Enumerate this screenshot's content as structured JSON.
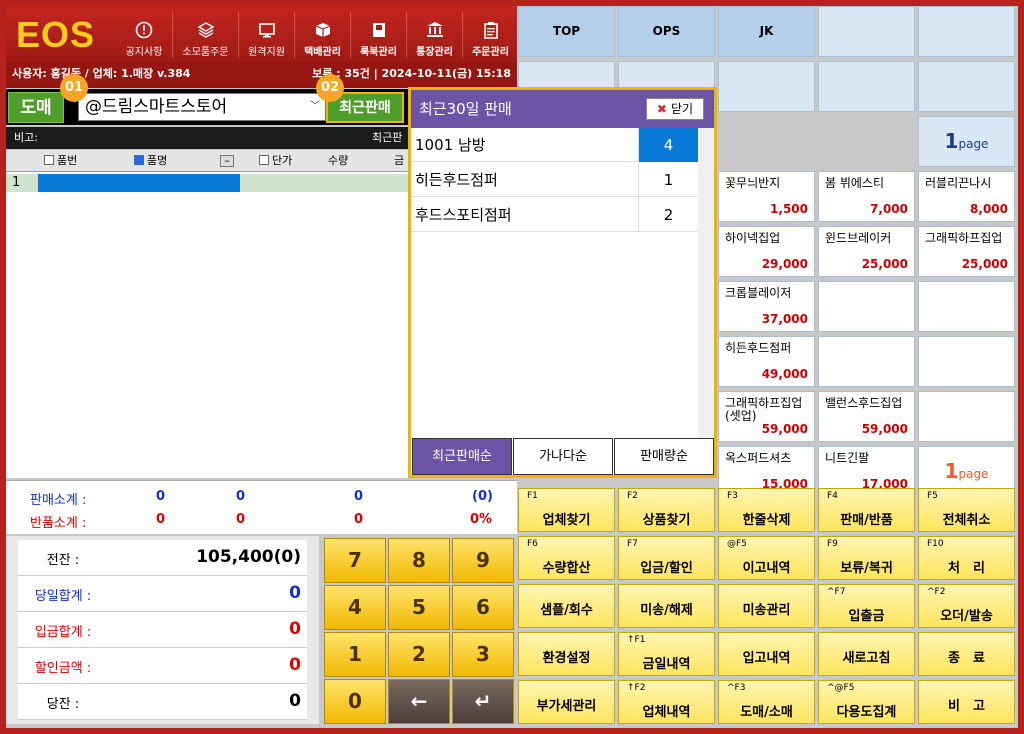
{
  "app": {
    "logo": "EOS"
  },
  "menu": [
    {
      "label": "공지사항",
      "icon": "alert-circle-icon",
      "bold": false
    },
    {
      "label": "소모품주문",
      "icon": "layers-icon",
      "bold": false
    },
    {
      "label": "원격지원",
      "icon": "monitor-icon",
      "bold": false
    },
    {
      "label": "택배관리",
      "icon": "box-icon",
      "bold": true
    },
    {
      "label": "룩북관리",
      "icon": "book-icon",
      "bold": true
    },
    {
      "label": "통장관리",
      "icon": "bank-icon",
      "bold": true
    },
    {
      "label": "주문관리",
      "icon": "clipboard-icon",
      "bold": true
    }
  ],
  "info": {
    "left": "사용자: 홍길동 / 업체: 1.매장 v.384",
    "right": "보류 : 35건 | 2024-10-11(금) 15:18"
  },
  "toolbar": {
    "mode": "도매",
    "store": "@드림스마트스토어",
    "recent_button": "최근판매",
    "badge1": "01",
    "badge2": "02"
  },
  "memo": {
    "label": "비고:",
    "right": "최근판"
  },
  "grid": {
    "headers": {
      "code": "품번",
      "name": "품명",
      "collapse": "–",
      "unit": "단가",
      "qty": "수량",
      "amount": "금"
    },
    "row_no": "1"
  },
  "totals": {
    "sales_label": "판매소계 :",
    "sales": [
      "0",
      "0",
      "0",
      "(0)"
    ],
    "return_label": "반품소계 :",
    "returns": [
      "0",
      "0",
      "0",
      "0%"
    ]
  },
  "balances": [
    {
      "label": "전잔 :",
      "value": "105,400(0)",
      "color": "#000000"
    },
    {
      "label": "당일합계 :",
      "value": "0",
      "color": "#1030d0"
    },
    {
      "label": "입금합계 :",
      "value": "0",
      "color": "#e00000"
    },
    {
      "label": "할인금액 :",
      "value": "0",
      "color": "#e00000"
    },
    {
      "label": "당잔 :",
      "value": "0",
      "color": "#000000"
    }
  ],
  "numpad": [
    "7",
    "8",
    "9",
    "4",
    "5",
    "6",
    "1",
    "2",
    "3",
    "0",
    "←",
    "↵"
  ],
  "top_tabs": [
    "TOP",
    "OPS",
    "JK"
  ],
  "products": [
    {
      "name": "꽃무늬반지",
      "price": "1,500"
    },
    {
      "name": "봄 뷔에스티",
      "price": "7,000"
    },
    {
      "name": "러블리끈나시",
      "price": "8,000"
    },
    {
      "name": "하이넥집업",
      "price": "29,000"
    },
    {
      "name": "윈드브레이커",
      "price": "25,000"
    },
    {
      "name": "그래픽하프집업",
      "price": "25,000"
    },
    {
      "name": "크롭블레이저",
      "price": "37,000"
    },
    {
      "name": "히든후드점퍼",
      "price": "49,000"
    },
    {
      "name": "그래픽하프집업(셋업)",
      "price": "59,000"
    },
    {
      "name": "밸런스후드집업",
      "price": "59,000"
    },
    {
      "name": "옥스퍼드셔츠",
      "price": "15,000"
    },
    {
      "name": "니트긴팔",
      "price": "17,000"
    }
  ],
  "pages": {
    "top": "1",
    "bottom": "1",
    "unit": "page"
  },
  "fkeys": [
    {
      "key": "F1",
      "label": "업체찾기"
    },
    {
      "key": "F2",
      "label": "상품찾기"
    },
    {
      "key": "F3",
      "label": "한줄삭제"
    },
    {
      "key": "F4",
      "label": "판매/반품"
    },
    {
      "key": "F5",
      "label": "전체취소"
    },
    {
      "key": "F6",
      "label": "수량합산"
    },
    {
      "key": "F7",
      "label": "입금/할인"
    },
    {
      "key": "@F5",
      "label": "이고내역"
    },
    {
      "key": "F9",
      "label": "보류/복귀"
    },
    {
      "key": "F10",
      "label": "처　리"
    },
    {
      "key": "",
      "label": "샘플/회수"
    },
    {
      "key": "",
      "label": "미송/해제"
    },
    {
      "key": "",
      "label": "미송관리"
    },
    {
      "key": "^F7",
      "label": "입출금"
    },
    {
      "key": "^F2",
      "label": "오더/발송"
    },
    {
      "key": "",
      "label": "환경설정"
    },
    {
      "key": "↑F1",
      "label": "금일내역"
    },
    {
      "key": "",
      "label": "입고내역"
    },
    {
      "key": "",
      "label": "새로고침"
    },
    {
      "key": "",
      "label": "종　료"
    },
    {
      "key": "",
      "label": "부가세관리"
    },
    {
      "key": "↑F2",
      "label": "업체내역"
    },
    {
      "key": "^F3",
      "label": "도매/소매"
    },
    {
      "key": "^@F5",
      "label": "다용도집계"
    },
    {
      "key": "",
      "label": "비　고"
    }
  ],
  "popup": {
    "title": "최근30일 판매",
    "close": "닫기",
    "rows": [
      {
        "name": "1001 남방",
        "qty": "4"
      },
      {
        "name": "히든후드점퍼",
        "qty": "1"
      },
      {
        "name": "후드스포티점퍼",
        "qty": "2"
      }
    ],
    "tabs": [
      "최근판매순",
      "가나다순",
      "판매량순"
    ]
  }
}
